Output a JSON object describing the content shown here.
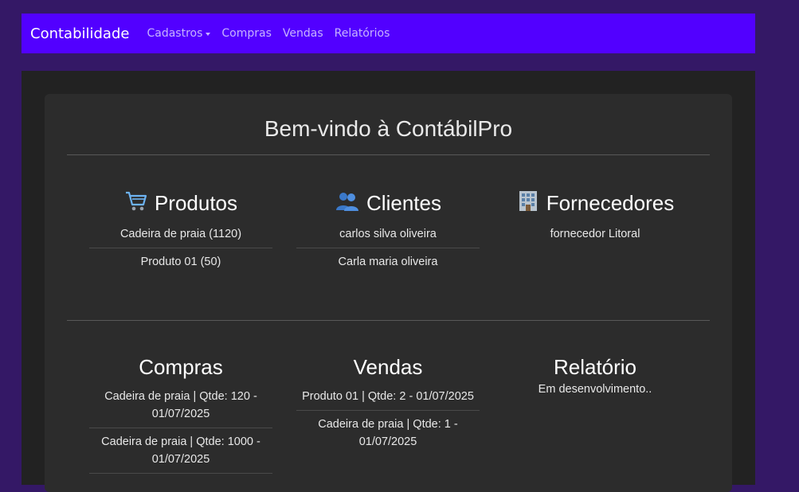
{
  "navbar": {
    "brand": "Contabilidade",
    "links": [
      "Cadastros",
      "Compras",
      "Vendas",
      "Relatórios"
    ]
  },
  "main": {
    "title": "Bem-vindo à ContábilPro",
    "produtos": {
      "heading": "Produtos",
      "icon": "shopping-cart-icon",
      "items": [
        "Cadeira de praia (1120)",
        "Produto 01 (50)"
      ]
    },
    "clientes": {
      "heading": "Clientes",
      "icon": "people-icon",
      "items": [
        "carlos silva oliveira",
        "Carla maria oliveira"
      ]
    },
    "fornecedores": {
      "heading": "Fornecedores",
      "icon": "office-building-icon",
      "items": [
        "fornecedor Litoral"
      ]
    },
    "compras": {
      "heading": "Compras",
      "items": [
        "Cadeira de praia | Qtde: 120 - 01/07/2025",
        "Cadeira de praia | Qtde: 1000 - 01/07/2025"
      ]
    },
    "vendas": {
      "heading": "Vendas",
      "items": [
        "Produto 01 | Qtde: 2 - 01/07/2025",
        "Cadeira de praia | Qtde: 1 - 01/07/2025"
      ]
    },
    "relatorio": {
      "heading": "Relatório",
      "note": "Em desenvolvimento.."
    }
  },
  "colors": {
    "navbar": "#5200ff",
    "page_bg": "#341866",
    "card_bg": "#2c2c2c"
  }
}
